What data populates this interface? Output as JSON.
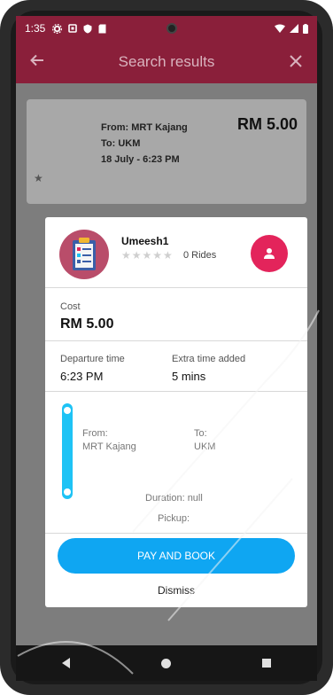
{
  "status_bar": {
    "time": "1:35"
  },
  "app_bar": {
    "title": "Search results"
  },
  "background_card": {
    "from": "From: MRT Kajang",
    "to": "To: UKM",
    "date": "18 July - 6:23 PM",
    "price": "RM 5.00"
  },
  "dialog": {
    "driver_name": "Umeesh1",
    "rating_stars": "★★★★★",
    "rides": "0 Rides",
    "cost_label": "Cost",
    "cost_value": "RM 5.00",
    "departure_label": "Departure time",
    "departure_value": "6:23 PM",
    "extra_label": "Extra time added",
    "extra_value": "5 mins",
    "from_label": "From:",
    "from_value": "MRT Kajang",
    "to_label": "To:",
    "to_value": "UKM",
    "duration": "Duration: null",
    "pickup": "Pickup:",
    "pay_button": "PAY AND BOOK",
    "dismiss_button": "Dismiss"
  },
  "icons": {
    "back": "arrow-left-icon",
    "close": "close-icon",
    "profile": "person-icon",
    "avatar": "clipboard-icon"
  },
  "colors": {
    "primary": "#8a1f3a",
    "accent": "#e3245b",
    "button": "#0fa6f2",
    "route": "#1ec3f5"
  }
}
